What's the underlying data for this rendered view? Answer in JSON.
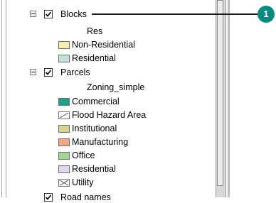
{
  "toc": {
    "blocks": {
      "label": "Blocks",
      "field": "Res",
      "classes": [
        {
          "label": "Non-Residential",
          "color": "#f4eeb0"
        },
        {
          "label": "Residential",
          "color": "#bfe3d6"
        }
      ]
    },
    "parcels": {
      "label": "Parcels",
      "field": "Zoning_simple",
      "classes": [
        {
          "label": "Commercial",
          "color": "#17a589"
        },
        {
          "label": "Flood Hazard Area",
          "color": "#ffffff",
          "icon": "hatch-icon"
        },
        {
          "label": "Institutional",
          "color": "#d8d591"
        },
        {
          "label": "Manufacturing",
          "color": "#f4a582"
        },
        {
          "label": "Office",
          "color": "#a6d496"
        },
        {
          "label": "Residential",
          "color": "#e3d7ef"
        },
        {
          "label": "Utility",
          "color": "#ffffff",
          "icon": "utility-x-icon"
        }
      ]
    },
    "road_names": {
      "label": "Road names"
    }
  },
  "callout": {
    "number": "1",
    "color": "#0a8a80"
  }
}
